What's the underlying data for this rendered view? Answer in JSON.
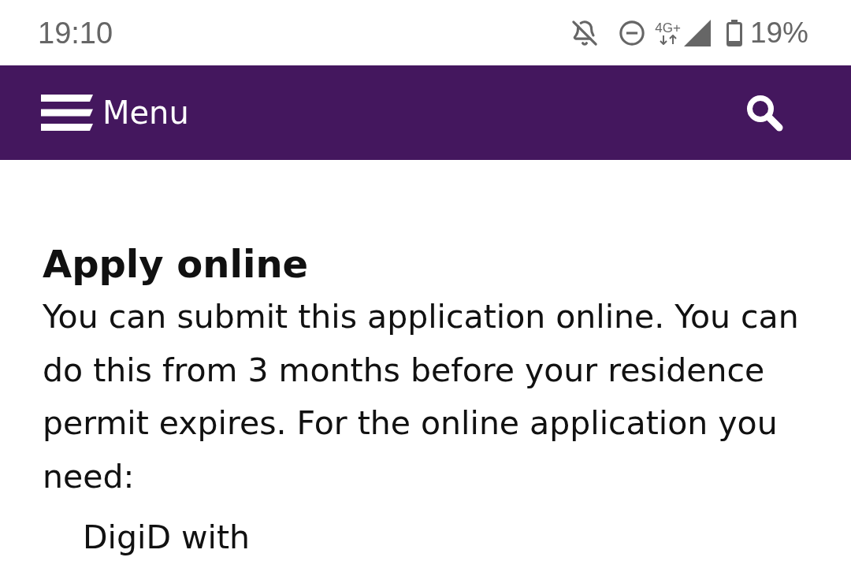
{
  "status_bar": {
    "time": "19:10",
    "network": "4G+",
    "battery": "19%"
  },
  "header": {
    "menu_label": "Menu"
  },
  "content": {
    "heading": "Apply online",
    "paragraph": "You can submit this application online. You can do this from 3 months before your residence permit expires. For the online application you need:",
    "list": [
      "DigiD with"
    ]
  }
}
